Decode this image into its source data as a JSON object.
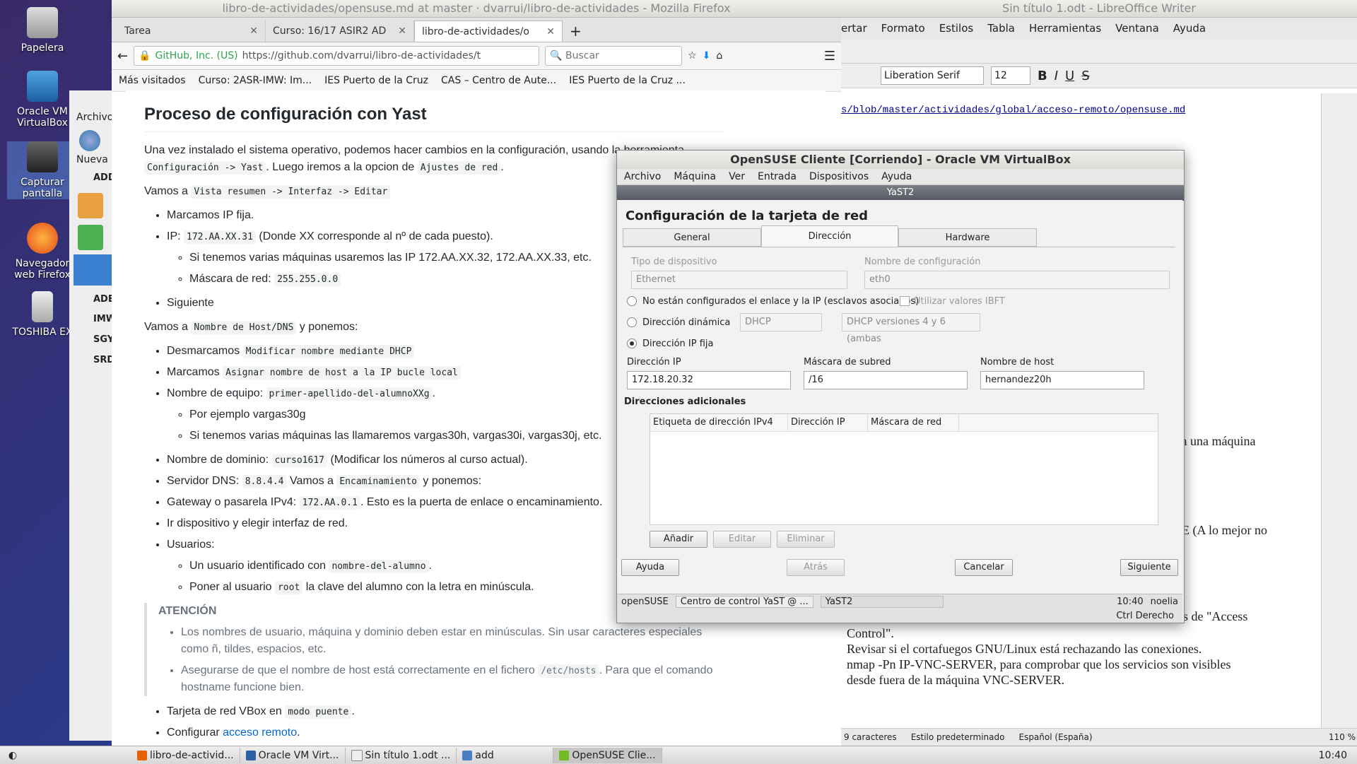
{
  "desktop": {
    "icons": [
      {
        "label": "Papelera"
      },
      {
        "label": "Oracle VM VirtualBox"
      },
      {
        "label": "Capturar pantalla"
      },
      {
        "label": "Navegador web Firefox"
      },
      {
        "label": "TOSHIBA EX"
      }
    ]
  },
  "firefox": {
    "title": "libro-de-actividades/opensuse.md at master · dvarrui/libro-de-actividades - Mozilla Firefox",
    "tabs": [
      {
        "label": "Tarea"
      },
      {
        "label": "Curso: 16/17 ASIR2 AD"
      },
      {
        "label": "libro-de-actividades/o"
      }
    ],
    "url_identity": "GitHub, Inc. (US)",
    "url": "https://github.com/dvarrui/libro-de-actividades/t",
    "search_placeholder": "Buscar",
    "bookmarks": [
      "Más visitados",
      "Curso: 2ASR-IMW: Im...",
      "IES Puerto de la Cruz",
      "CAS – Centro de Aute...",
      "IES Puerto de la Cruz ..."
    ]
  },
  "leftstrip": {
    "archivo": "Archivo",
    "nueva": "Nueva",
    "groups": [
      "ADD",
      "ADE",
      "IMW",
      "SGY",
      "SRD"
    ]
  },
  "doc": {
    "heading": "Proceso de configuración con Yast",
    "p1_a": "Una vez instalado el sistema operativo, podemos hacer cambios en la configuración, usando la herramienta",
    "p1_code1": "Configuración -> Yast",
    "p1_b": ". Luego iremos a la opcion de",
    "p1_code2": "Ajustes de red",
    "p1_c": ".",
    "p2_a": "Vamos a",
    "p2_code": "Vista resumen -> Interfaz -> Editar",
    "l1": "Marcamos IP fija.",
    "l2_a": "IP:",
    "l2_code": "172.AA.XX.31",
    "l2_b": "(Donde XX corresponde al nº de cada puesto).",
    "l2_sub1": "Si tenemos varias máquinas usaremos las IP 172.AA.XX.32, 172.AA.XX.33, etc.",
    "l2_sub2_a": "Máscara de red:",
    "l2_sub2_code": "255.255.0.0",
    "l3": "Siguiente",
    "p3_a": "Vamos a",
    "p3_code": "Nombre de Host/DNS",
    "p3_b": "y ponemos:",
    "m1_a": "Desmarcamos",
    "m1_code": "Modificar nombre mediante DHCP",
    "m2_a": "Marcamos",
    "m2_code": "Asignar nombre de host a la IP bucle local",
    "m3_a": "Nombre de equipo:",
    "m3_code": "primer-apellido-del-alumnoXXg",
    "m3_b": ".",
    "m3_sub1": "Por ejemplo vargas30g",
    "m3_sub2": "Si tenemos varias máquinas las llamaremos vargas30h, vargas30i, vargas30j, etc.",
    "m4_a": "Nombre de dominio:",
    "m4_code": "curso1617",
    "m4_b": "(Modificar los números al curso actual).",
    "m5_a": "Servidor DNS:",
    "m5_code1": "8.8.4.4",
    "m5_b": "Vamos a",
    "m5_code2": "Encaminamiento",
    "m5_c": "y ponemos:",
    "m6_a": "Gateway o pasarela IPv4:",
    "m6_code": "172.AA.0.1",
    "m6_b": ". Esto es la puerta de enlace o encaminamiento.",
    "m7": "Ir dispositivo y elegir interfaz de red.",
    "m8": "Usuarios:",
    "m8_sub1_a": "Un usuario identificado con",
    "m8_sub1_code": "nombre-del-alumno",
    "m8_sub1_b": ".",
    "m8_sub2_a": "Poner al usuario",
    "m8_sub2_code": "root",
    "m8_sub2_b": "la clave del alumno con la letra en minúscula.",
    "warn_title": "ATENCIÓN",
    "warn1": "Los nombres de usuario, máquina y dominio deben estar en minúsculas. Sin usar caracteres especiales como ñ, tildes, espacios, etc.",
    "warn2_a": "Asegurarse de que el nombre de host está correctamente en el fichero",
    "warn2_code": "/etc/hosts",
    "warn2_b": ". Para que el comando hostname funcione bien.",
    "e1_a": "Tarjeta de red VBox en",
    "e1_code": "modo puente",
    "e1_b": ".",
    "e2_a": "Configurar",
    "e2_link": "acceso remoto",
    "e2_b": "."
  },
  "writer": {
    "title": "Sin título 1.odt - LibreOffice Writer",
    "menu": [
      "ertar",
      "Formato",
      "Estilos",
      "Tabla",
      "Herramientas",
      "Ventana",
      "Ayuda"
    ],
    "font_name": "Liberation Serif",
    "font_size": "12",
    "page_link": "s/blob/master/actividades/global/acceso-remoto/opensuse.md",
    "t1": "eder a una máquina",
    "t2": "E (A lo mejor no",
    "t3": "s de \"Access",
    "t4": "Control\".",
    "t5": "Revisar si el cortafuegos GNU/Linux está rechazando las conexiones.",
    "t6": "nmap -Pn IP-VNC-SERVER, para comprobar que los servicios son visibles",
    "t7": "desde fuera de la máquina VNC-SERVER.",
    "status_chars": "9 caracteres",
    "status_style": "Estilo predeterminado",
    "status_lang": "Español (España)",
    "status_zoom": "110 %"
  },
  "vbox": {
    "title": "OpenSUSE Cliente [Corriendo] - Oracle VM VirtualBox",
    "menu": [
      "Archivo",
      "Máquina",
      "Ver",
      "Entrada",
      "Dispositivos",
      "Ayuda"
    ],
    "yast_title": "YaST2",
    "heading": "Configuración de la tarjeta de red",
    "tabs": [
      "General",
      "Dirección",
      "Hardware"
    ],
    "device_type_label": "Tipo de dispositivo",
    "device_type_value": "Ethernet",
    "config_name_label": "Nombre de configuración",
    "config_name_value": "eth0",
    "opt_none": "No están configurados el enlace y la IP (esclavos asociados)",
    "ibft": "Utilizar valores IBFT",
    "opt_dynamic": "Dirección dinámica",
    "dhcp": "DHCP",
    "dhcp_versions": "DHCP versiones 4 y 6 (ambas",
    "opt_static": "Dirección IP fija",
    "ip_label": "Dirección IP",
    "ip_value": "172.18.20.32",
    "mask_label": "Máscara de subred",
    "mask_value": "/16",
    "host_label": "Nombre de host",
    "host_value": "hernandez20h",
    "additional": "Direcciones adicionales",
    "cols": [
      "Etiqueta de dirección IPv4",
      "Dirección IP",
      "Máscara de red"
    ],
    "btn_add": "Añadir",
    "btn_edit": "Editar",
    "btn_delete": "Eliminar",
    "btn_help": "Ayuda",
    "btn_back": "Atrás",
    "btn_cancel": "Cancelar",
    "btn_next": "Siguiente",
    "guest_taskbar": [
      "openSUSE",
      "Centro de control YaST @ ...",
      "YaST2"
    ],
    "guest_time": "10:40",
    "guest_user": "noelia",
    "host_key": "Ctrl Derecho"
  },
  "taskbar": {
    "items": [
      "libro-de-activid...",
      "Oracle VM Virt...",
      "Sin título 1.odt ...",
      "add",
      "OpenSUSE Clie..."
    ],
    "time": "10:40"
  },
  "colors": {
    "accent_link": "#0366d6",
    "github_green": "#2ea44f"
  }
}
